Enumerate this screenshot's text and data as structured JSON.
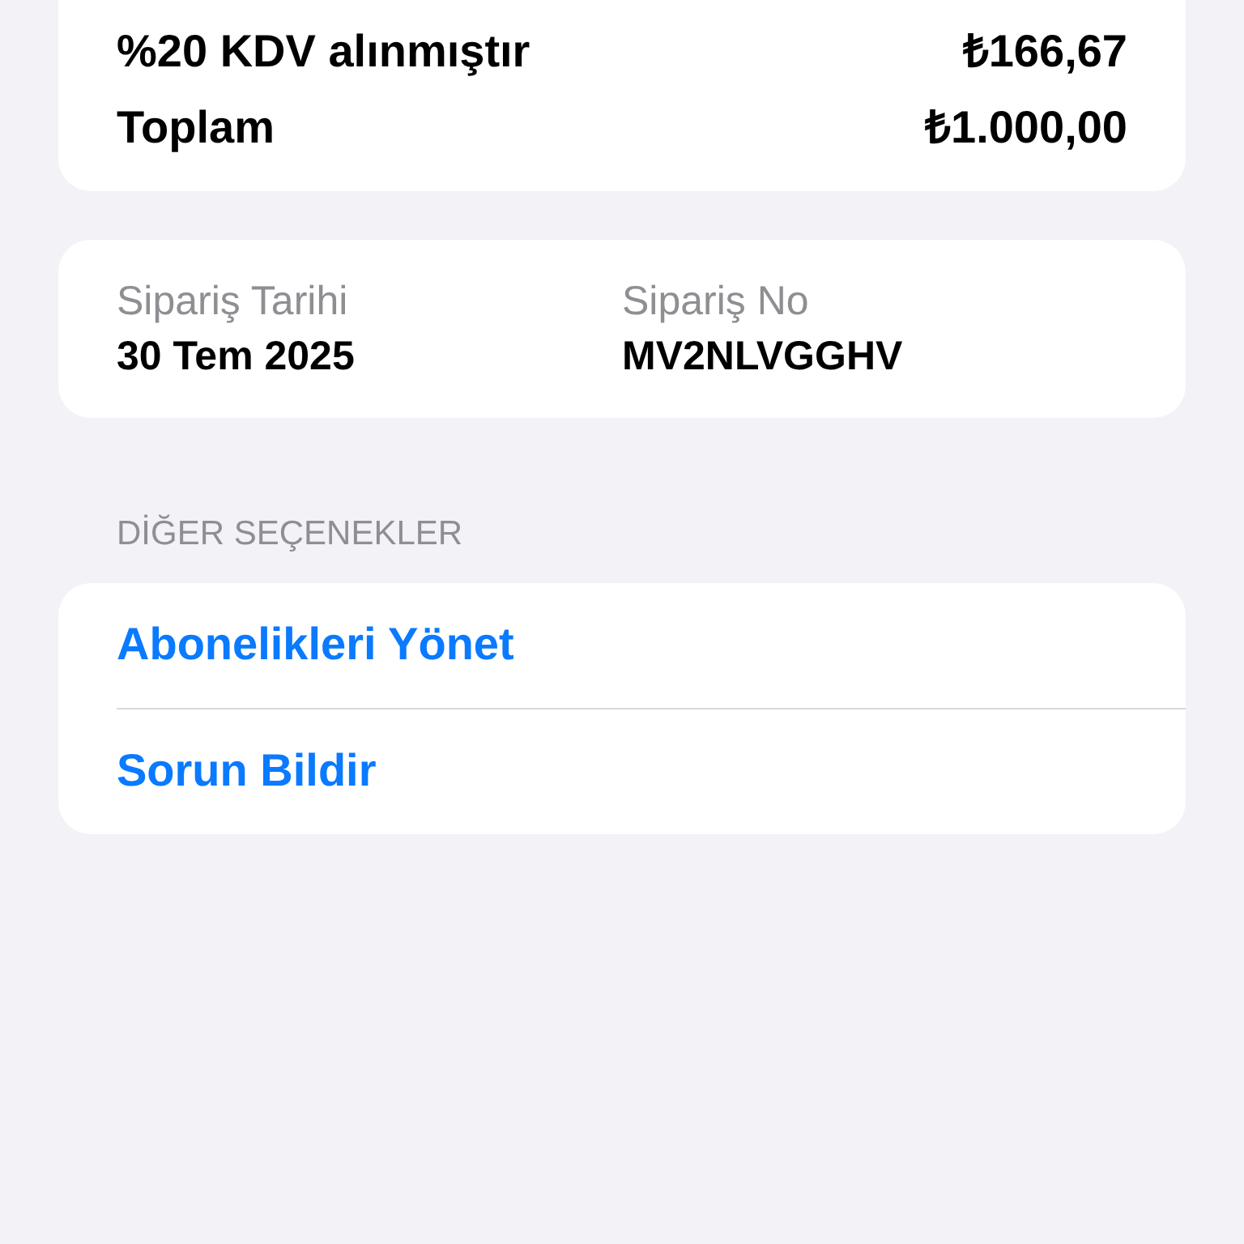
{
  "summary": {
    "rows": [
      {
        "label": "%20 KDV alınmıştır",
        "value": "₺166,67"
      },
      {
        "label": "Toplam",
        "value": "₺1.000,00"
      }
    ]
  },
  "order": {
    "fields": [
      {
        "label": "Sipariş Tarihi",
        "value": "30 Tem 2025"
      },
      {
        "label": "Sipariş No",
        "value": "MV2NLVGGHV"
      }
    ]
  },
  "other_options": {
    "header": "DİĞER SEÇENEKLER",
    "items": [
      "Abonelikleri Yönet",
      "Sorun Bildir"
    ]
  }
}
